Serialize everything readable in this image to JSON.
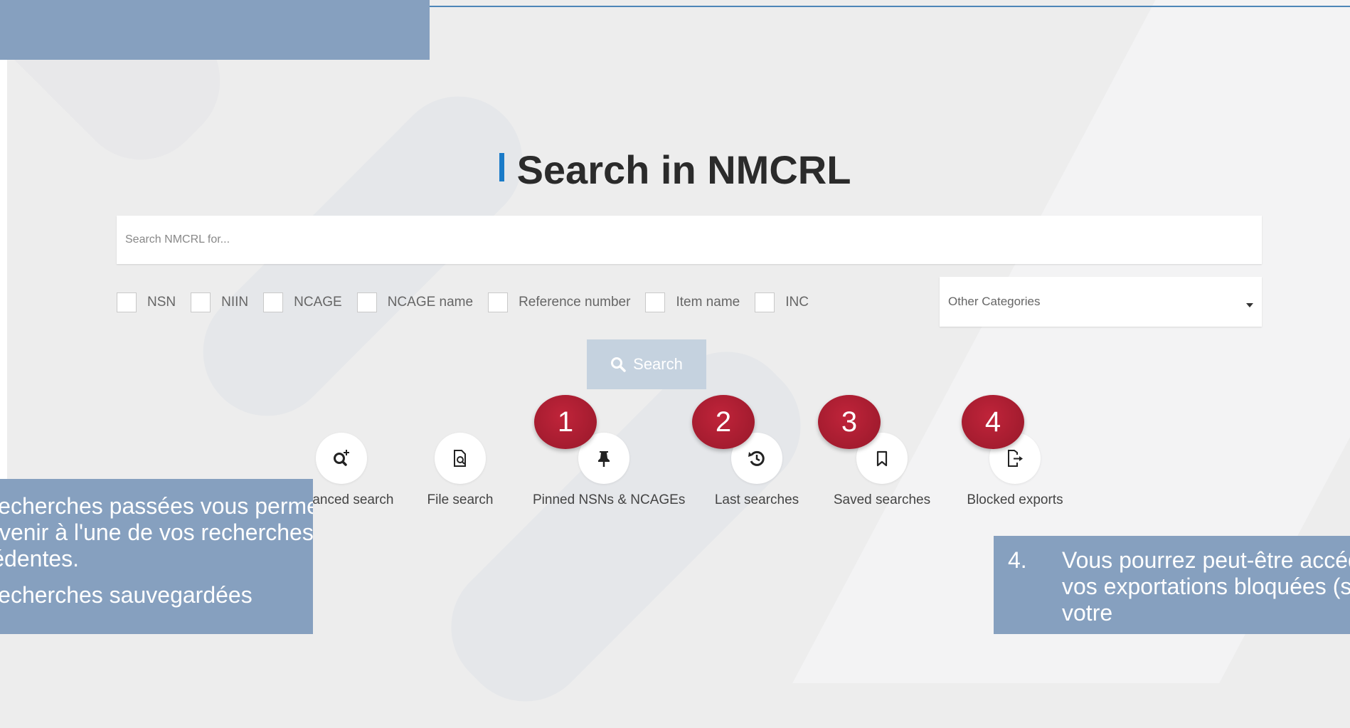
{
  "title": "Search in NMCRL",
  "search": {
    "placeholder": "Search NMCRL for..."
  },
  "filters": [
    "NSN",
    "NIIN",
    "NCAGE",
    "NCAGE name",
    "Reference number",
    "Item name",
    "INC"
  ],
  "category_select": {
    "selected": "Other Categories"
  },
  "search_button": {
    "label": "Search"
  },
  "tools": [
    {
      "label": "Advanced search",
      "icon": "advanced-search-icon"
    },
    {
      "label": "File search",
      "icon": "file-search-icon"
    },
    {
      "label": "Pinned NSNs & NCAGEs",
      "icon": "pin-icon"
    },
    {
      "label": "Last searches",
      "icon": "history-icon"
    },
    {
      "label": "Saved searches",
      "icon": "bookmark-icon"
    },
    {
      "label": "Blocked exports",
      "icon": "export-icon"
    }
  ],
  "badges": [
    "1",
    "2",
    "3",
    "4"
  ],
  "notes": {
    "left": [
      "Les recherches passées vous permettent de revenir à l'une de vos recherches précédentes.",
      "Les recherches sauvegardées"
    ],
    "right": {
      "number": "4.",
      "text": "Vous pourrez peut-être accéder à vos exportations bloquées (selon votre"
    }
  },
  "colors": {
    "accent": "#1a7bc8",
    "badge": "#a81c30",
    "note_panel": "#86a0bf",
    "search_button": "#c5d2df"
  }
}
